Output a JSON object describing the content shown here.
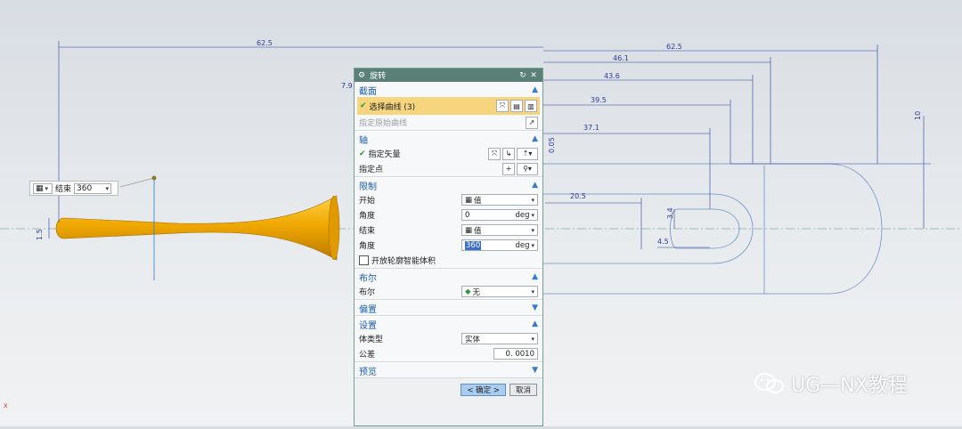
{
  "window": {
    "title": "旋转"
  },
  "dialog": {
    "sections": {
      "section": {
        "title": "截面",
        "select_curve": "选择曲线 (3)",
        "specify_original": "指定原始曲线"
      },
      "axis": {
        "title": "轴",
        "specify_vector": "指定矢量",
        "specify_point": "指定点"
      },
      "limits": {
        "title": "限制",
        "start_label": "开始",
        "start_value": "值",
        "angle1_label": "角度",
        "angle1_value": "0",
        "angle1_unit": "deg",
        "end_label": "结束",
        "end_value": "值",
        "angle2_label": "角度",
        "angle2_value": "360",
        "angle2_unit": "deg",
        "open_profile": "开放轮廓智能体积"
      },
      "boolean": {
        "title": "布尔",
        "label": "布尔",
        "value": "无"
      },
      "offset": {
        "title": "偏置"
      },
      "settings": {
        "title": "设置",
        "body_type_label": "体类型",
        "body_type_value": "实体",
        "tolerance_label": "公差",
        "tolerance_value": "0. 0010"
      },
      "preview": {
        "title": "预览"
      }
    },
    "buttons": {
      "ok": "< 确定 >",
      "cancel": "取消"
    }
  },
  "float_toolbar": {
    "label": "结束",
    "value": "360"
  },
  "dimensions": {
    "d62_5_left": "62.5",
    "d62_5_right": "62.5",
    "d46_1": "46.1",
    "d43_6": "43.6",
    "d39_5": "39.5",
    "d37_1": "37.1",
    "d20_5": "20.5",
    "d4_5": "4.5",
    "d7_9": "7.9",
    "d1_5": "1.5",
    "d10": "10",
    "d0_05": "0.05",
    "d3_4": "3.4"
  },
  "watermark": {
    "text": "UG—NX教程"
  },
  "axis_marker": "x",
  "colors": {
    "title_bar": "#5b8078",
    "section_text": "#1d5fa8",
    "highlight": "#f7d57f",
    "model": "#f0a800",
    "dim_line": "#2a3c9a"
  }
}
